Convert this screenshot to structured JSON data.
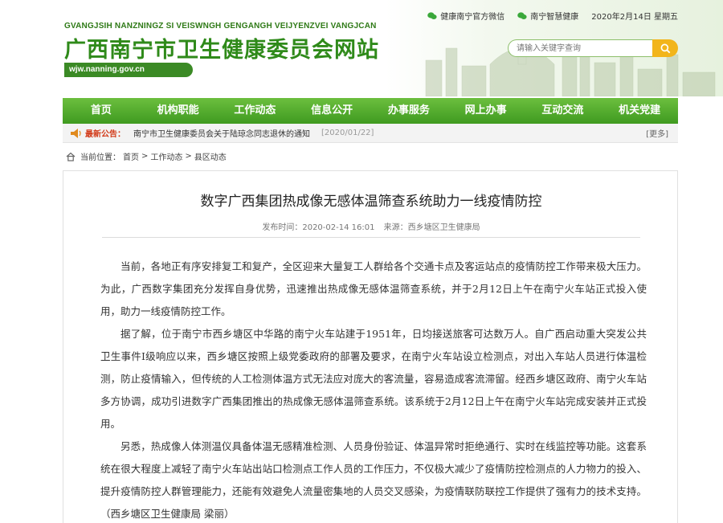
{
  "header": {
    "zhuang_name": "GVANGJSIH NANZNINGZ SI VEISWNGH GENGANGH VEIJYENZVEI VANGJCAN",
    "site_title": "广西南宁市卫生健康委员会网站",
    "domain": "wjw.nanning.gov.cn",
    "top_links": [
      "健康南宁官方微信",
      "南宁智慧健康"
    ],
    "date": "2020年2月14日 星期五",
    "search_placeholder": "请输入关键字查询",
    "accent_color": "#3f9a20"
  },
  "nav": {
    "items": [
      "首页",
      "机构职能",
      "工作动态",
      "信息公开",
      "办事服务",
      "网上办事",
      "互动交流",
      "机关党建"
    ]
  },
  "notice": {
    "label": "最新公告：",
    "text": "南宁市卫生健康委员会关于陆琼念同志退休的通知",
    "date": "[2020/01/22]",
    "more": "[更多]"
  },
  "breadcrumb": {
    "label": "当前位置：",
    "items": [
      "首页",
      "工作动态",
      "县区动态"
    ],
    "separator": ">"
  },
  "article": {
    "title": "数字广西集团热成像无感体温筛查系统助力一线疫情防控",
    "publish_time": "发布时间：2020-02-14 16:01",
    "source": "来源：西乡塘区卫生健康局",
    "paragraphs": [
      "当前，各地正有序安排复工和复产，全区迎来大量复工人群给各个交通卡点及客运站点的疫情防控工作带来极大压力。为此，广西数字集团充分发挥自身优势，迅速推出热成像无感体温筛查系统，并于2月12日上午在南宁火车站正式投入使用，助力一线疫情防控工作。",
      "据了解，位于南宁市西乡塘区中华路的南宁火车站建于1951年，日均接送旅客可达数万人。自广西启动重大突发公共卫生事件I级响应以来，西乡塘区按照上级党委政府的部署及要求，在南宁火车站设立检测点，对出入车站人员进行体温检测，防止疫情输入，但传统的人工检测体温方式无法应对庞大的客流量，容易造成客流滞留。经西乡塘区政府、南宁火车站多方协调，成功引进数字广西集团推出的热成像无感体温筛查系统。该系统于2月12日上午在南宁火车站完成安装并正式投用。",
      "另悉，热成像人体测温仪具备体温无感精准检测、人员身份验证、体温异常时拒绝通行、实时在线监控等功能。这套系统在很大程度上减轻了南宁火车站出站口检测点工作人员的工作压力，不仅极大减少了疫情防控检测点的人力物力的投入、提升疫情防控人群管理能力，还能有效避免人流量密集地的人员交叉感染，为疫情联防联控工作提供了强有力的技术支持。（西乡塘区卫生健康局 梁丽）"
    ]
  }
}
